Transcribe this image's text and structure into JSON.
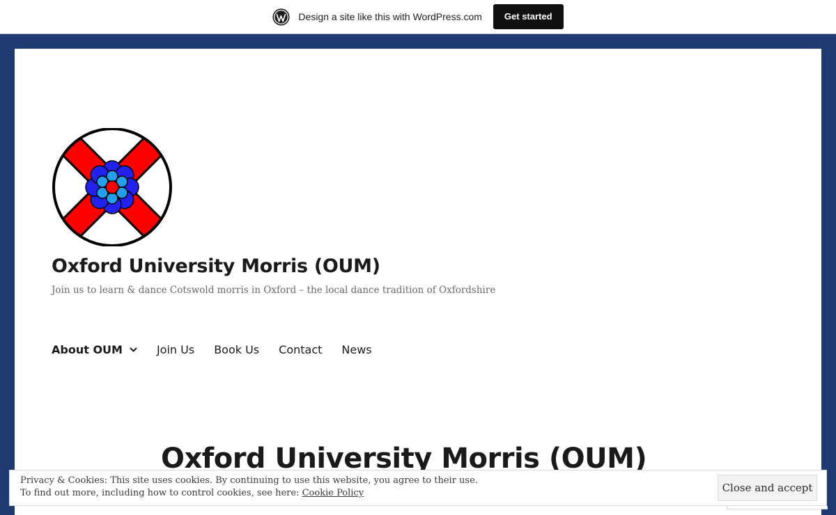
{
  "wpbar": {
    "logo_icon": "wordpress-logo-icon",
    "promo_text": "Design a site like this with WordPress.com",
    "cta_label": "Get started"
  },
  "site": {
    "logo_icon": "oum-cross-flower-logo",
    "title": "Oxford University Morris (OUM)",
    "tagline": "Join us to learn & dance Cotswold morris in Oxford – the local dance tradition of Oxfordshire"
  },
  "nav": {
    "items": [
      {
        "label": "About OUM",
        "active": true,
        "has_submenu": true
      },
      {
        "label": "Join Us"
      },
      {
        "label": "Book Us"
      },
      {
        "label": "Contact"
      },
      {
        "label": "News"
      }
    ]
  },
  "entry": {
    "title": "Oxford University Morris (OUM)"
  },
  "cookie": {
    "line1": "Privacy & Cookies: This site uses cookies. By continuing to use this website, you agree to their use.",
    "line2_prefix": "To find out more, including how to control cookies, see here: ",
    "link_label": "Cookie Policy",
    "accept_label": "Close and accept"
  },
  "colors": {
    "page_background": "#1e3a70",
    "logo_red": "#ff0000",
    "logo_blue": "#2222ee",
    "logo_light_blue": "#22a0ee"
  }
}
